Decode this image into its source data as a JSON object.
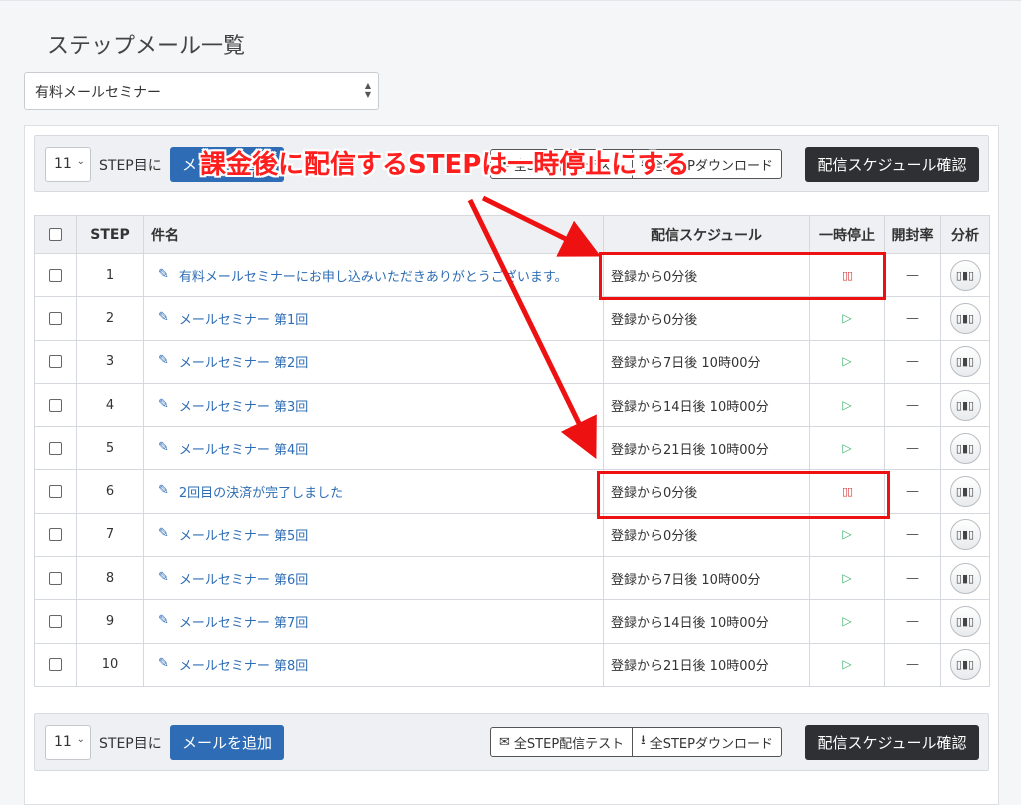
{
  "page": {
    "title": "ステップメール一覧",
    "course_select": "有料メールセミナー"
  },
  "toolbar": {
    "step_count": "11",
    "step_suffix": "STEP目に",
    "add_button": "メールを追加",
    "test_button": "全STEP配信テスト",
    "download_button": "全STEPダウンロード",
    "schedule_button": "配信スケジュール確認",
    "test_icon": "envelope-icon",
    "download_icon": "download-icon"
  },
  "table": {
    "headers": {
      "step": "STEP",
      "subject": "件名",
      "schedule": "配信スケジュール",
      "pause": "一時停止",
      "open_rate": "開封率",
      "analysis": "分析"
    },
    "rows": [
      {
        "step": "1",
        "subject": "有料メールセミナーにお申し込みいただきありがとうございます。",
        "schedule": "登録から0分後",
        "paused": true,
        "open_rate": "—"
      },
      {
        "step": "2",
        "subject": "メールセミナー 第1回",
        "schedule": "登録から0分後",
        "paused": false,
        "open_rate": "—"
      },
      {
        "step": "3",
        "subject": "メールセミナー 第2回",
        "schedule": "登録から7日後 10時00分",
        "paused": false,
        "open_rate": "—"
      },
      {
        "step": "4",
        "subject": "メールセミナー 第3回",
        "schedule": "登録から14日後 10時00分",
        "paused": false,
        "open_rate": "—"
      },
      {
        "step": "5",
        "subject": "メールセミナー 第4回",
        "schedule": "登録から21日後 10時00分",
        "paused": false,
        "open_rate": "—"
      },
      {
        "step": "6",
        "subject": "2回目の決済が完了しました",
        "schedule": "登録から0分後",
        "paused": true,
        "open_rate": "—"
      },
      {
        "step": "7",
        "subject": "メールセミナー 第5回",
        "schedule": "登録から0分後",
        "paused": false,
        "open_rate": "—"
      },
      {
        "step": "8",
        "subject": "メールセミナー 第6回",
        "schedule": "登録から7日後 10時00分",
        "paused": false,
        "open_rate": "—"
      },
      {
        "step": "9",
        "subject": "メールセミナー 第7回",
        "schedule": "登録から14日後 10時00分",
        "paused": false,
        "open_rate": "—"
      },
      {
        "step": "10",
        "subject": "メールセミナー 第8回",
        "schedule": "登録から21日後 10時00分",
        "paused": false,
        "open_rate": "—"
      }
    ]
  },
  "annotation": {
    "text": "課金後に配信するSTEPは一時停止にする",
    "color": "#ff1e1e"
  },
  "icons": {
    "edit": "pencil-icon",
    "play": "play-icon",
    "pause": "pause-icon",
    "analytics": "bar-chart-icon"
  }
}
